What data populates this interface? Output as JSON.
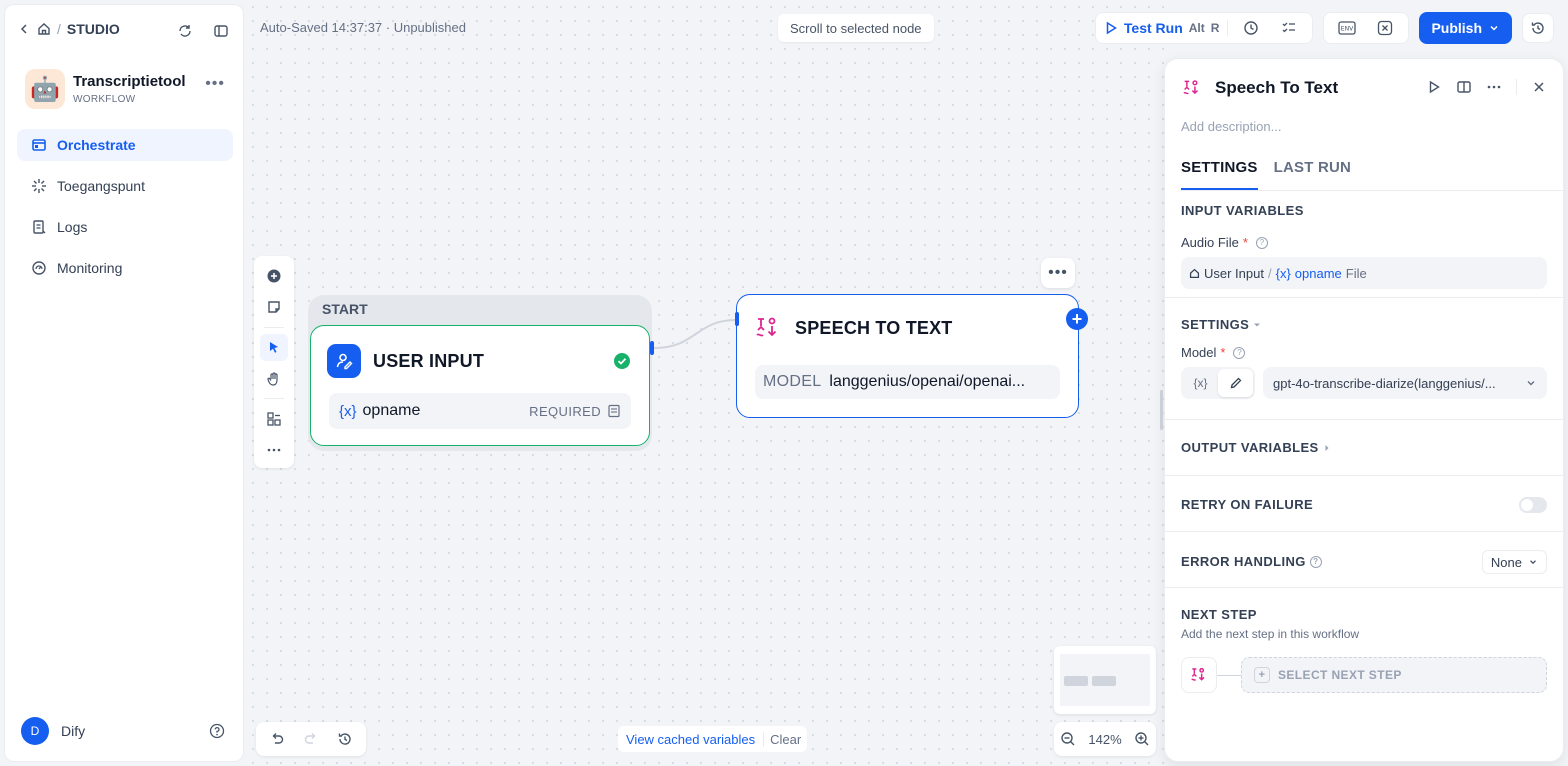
{
  "breadcrumb": {
    "studio": "STUDIO"
  },
  "app": {
    "name": "Transcriptietool",
    "type": "WORKFLOW"
  },
  "nav": {
    "items": [
      {
        "label": "Orchestrate"
      },
      {
        "label": "Toegangspunt"
      },
      {
        "label": "Logs"
      },
      {
        "label": "Monitoring"
      }
    ]
  },
  "user": {
    "initial": "D",
    "name": "Dify"
  },
  "canvas": {
    "autosave": "Auto-Saved 14:37:37 · Unpublished",
    "scroll_to_selected": "Scroll to selected node",
    "start_label": "START",
    "user_input_node": {
      "title": "USER INPUT",
      "var_brace": "{x}",
      "var_name": "opname",
      "var_required": "REQUIRED"
    },
    "stt_node": {
      "title": "SPEECH TO TEXT",
      "model_key": "MODEL",
      "model_value": "langgenius/openai/openai..."
    },
    "view_cached": "View cached variables",
    "clear": "Clear",
    "zoom": "142%"
  },
  "toolbar": {
    "test_run": "Test Run",
    "shortcut_alt": "Alt",
    "shortcut_r": "R",
    "publish": "Publish"
  },
  "panel": {
    "title": "Speech To Text",
    "description_placeholder": "Add description...",
    "tabs": [
      "SETTINGS",
      "LAST RUN"
    ],
    "input_variables_title": "INPUT VARIABLES",
    "audio_file_label": "Audio File",
    "required_mark": "*",
    "audio_var": {
      "node": "User Input",
      "sep": "/",
      "brace": "{x}",
      "name": "opname",
      "type": "File"
    },
    "settings_title": "SETTINGS",
    "model_label": "Model",
    "model_mode_var": "{x}",
    "model_value": "gpt-4o-transcribe-diarize(langgenius/...",
    "output_variables_title": "OUTPUT VARIABLES",
    "retry_title": "RETRY ON FAILURE",
    "retry_enabled": false,
    "error_handling_title": "ERROR HANDLING",
    "error_handling_value": "None",
    "next_step_title": "NEXT STEP",
    "next_step_sub": "Add the next step in this workflow",
    "select_next_step": "SELECT NEXT STEP"
  },
  "colors": {
    "accent": "#155eef",
    "success": "#17b26a",
    "stt_icon": "#dd2590"
  }
}
